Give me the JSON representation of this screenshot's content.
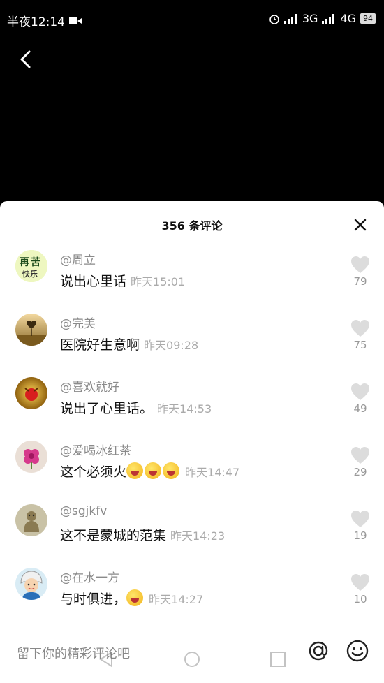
{
  "status_bar": {
    "time": "半夜12:14",
    "network": "3G",
    "network2": "4G",
    "battery": "94"
  },
  "comments_panel": {
    "title": "356 条评论",
    "comments": [
      {
        "user": "@周立",
        "text": "说出心里话",
        "time": "昨天15:01",
        "likes": "79",
        "avatar": "avatar-calligraphy"
      },
      {
        "user": "@完美",
        "text": "医院好生意啊",
        "time": "昨天09:28",
        "likes": "75",
        "avatar": "avatar-heart-tree"
      },
      {
        "user": "@喜欢就好",
        "text": "说出了心里话。",
        "time": "昨天14:53",
        "likes": "49",
        "avatar": "avatar-red-bird"
      },
      {
        "user": "@爱喝冰红茶",
        "text": "这个必须火",
        "time": "昨天14:47",
        "likes": "29",
        "avatar": "avatar-pink-flower"
      },
      {
        "user": "@sgjkfv",
        "text": "这不是蒙城的范集",
        "time": "昨天14:23",
        "likes": "19",
        "avatar": "avatar-statue"
      },
      {
        "user": "@在水一方",
        "text": "与时俱进，",
        "time": "昨天14:27",
        "likes": "10",
        "avatar": "avatar-cartoon-girl"
      }
    ]
  },
  "input_bar": {
    "placeholder": "留下你的精彩评论吧"
  },
  "colors": {
    "background": "#000000",
    "panel": "#ffffff",
    "username": "#8a8a8a",
    "timestamp": "#aaaaaa",
    "like_icon": "#d6d6d6"
  }
}
